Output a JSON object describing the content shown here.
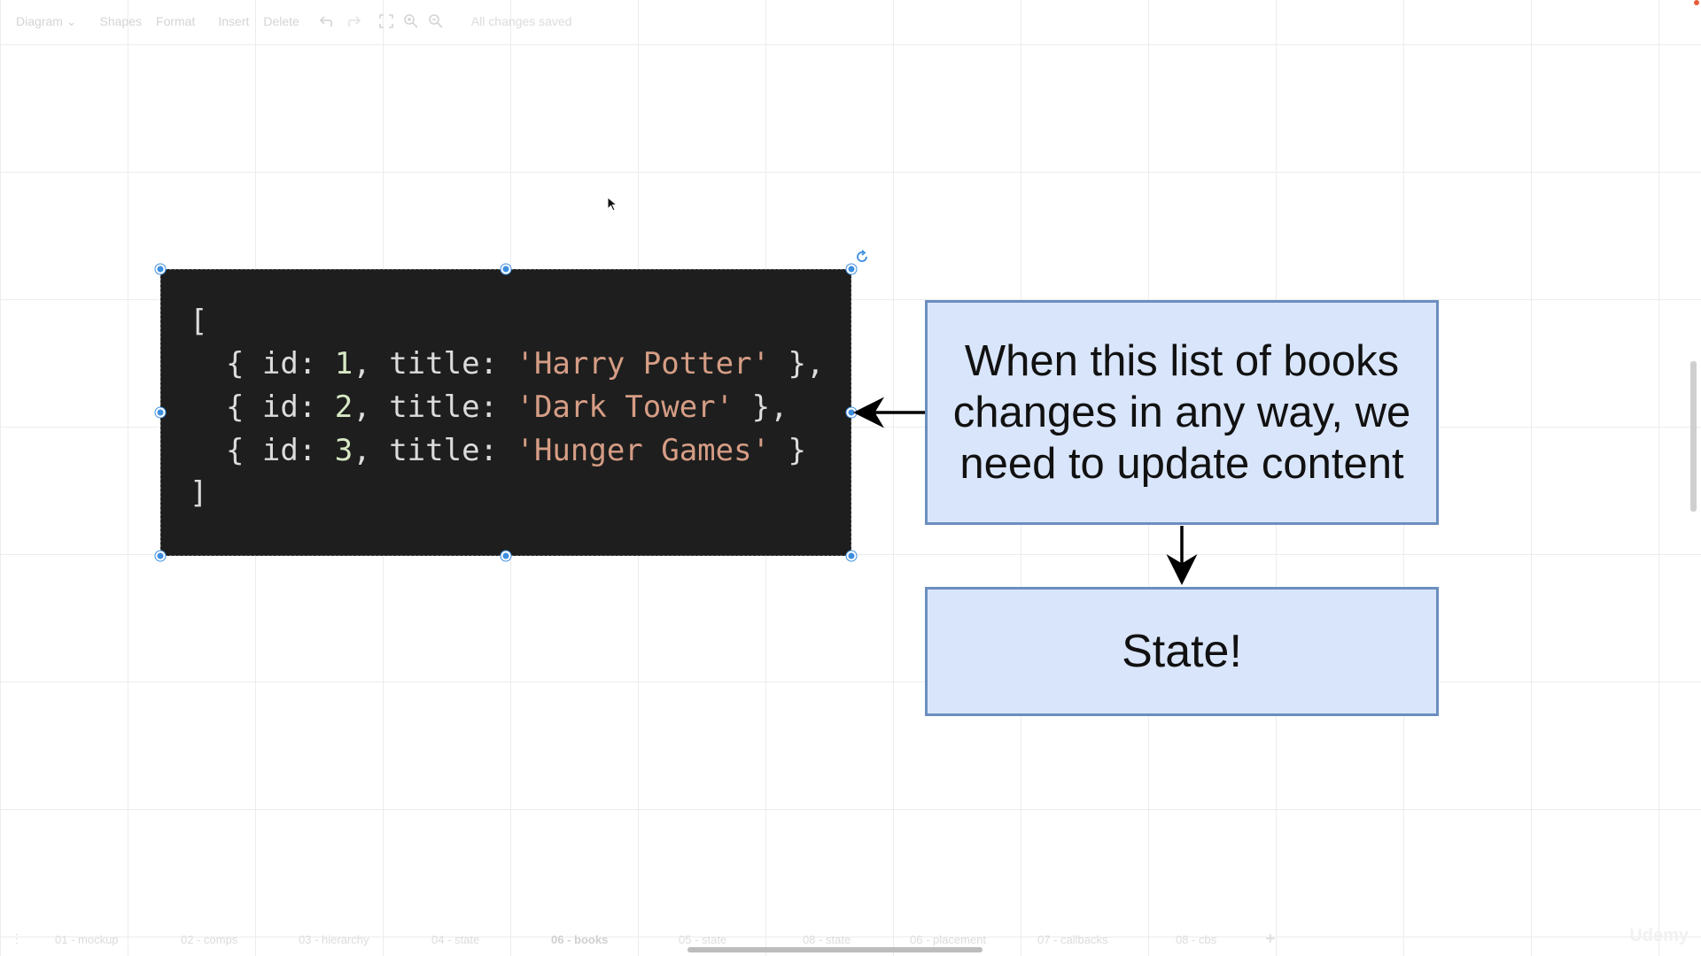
{
  "toolbar": {
    "diagram_label": "Diagram",
    "diagram_caret": "⌄",
    "shapes_label": "Shapes",
    "format_label": "Format",
    "insert_label": "Insert",
    "delete_label": "Delete",
    "status": "All changes saved"
  },
  "code": {
    "open_bracket": "[",
    "rows": [
      {
        "prefix": "  { id: ",
        "id": "1",
        "mid": ", title: ",
        "title": "'Harry Potter'",
        "suffix": " },"
      },
      {
        "prefix": "  { id: ",
        "id": "2",
        "mid": ", title: ",
        "title": "'Dark Tower'",
        "suffix": " },"
      },
      {
        "prefix": "  { id: ",
        "id": "3",
        "mid": ", title: ",
        "title": "'Hunger Games'",
        "suffix": " }"
      }
    ],
    "close_bracket": "]"
  },
  "note_box": {
    "text": "When this list of books changes in any way, we need to update content"
  },
  "state_box": {
    "text": "State!"
  },
  "page_tabs": [
    "01 - mockup",
    "02 - comps",
    "03 - hierarchy",
    "04 - state",
    "06 - books",
    "05 - state",
    "08 - state",
    "06 - placement",
    "07 - callbacks",
    "08 - cbs"
  ],
  "active_tab": "06 - books",
  "watermark": "Udemy",
  "colors": {
    "box_fill": "#d9e5fa",
    "box_border": "#6c8ebf",
    "code_bg": "#1e1e1e",
    "selection": "#3d8fe0"
  }
}
